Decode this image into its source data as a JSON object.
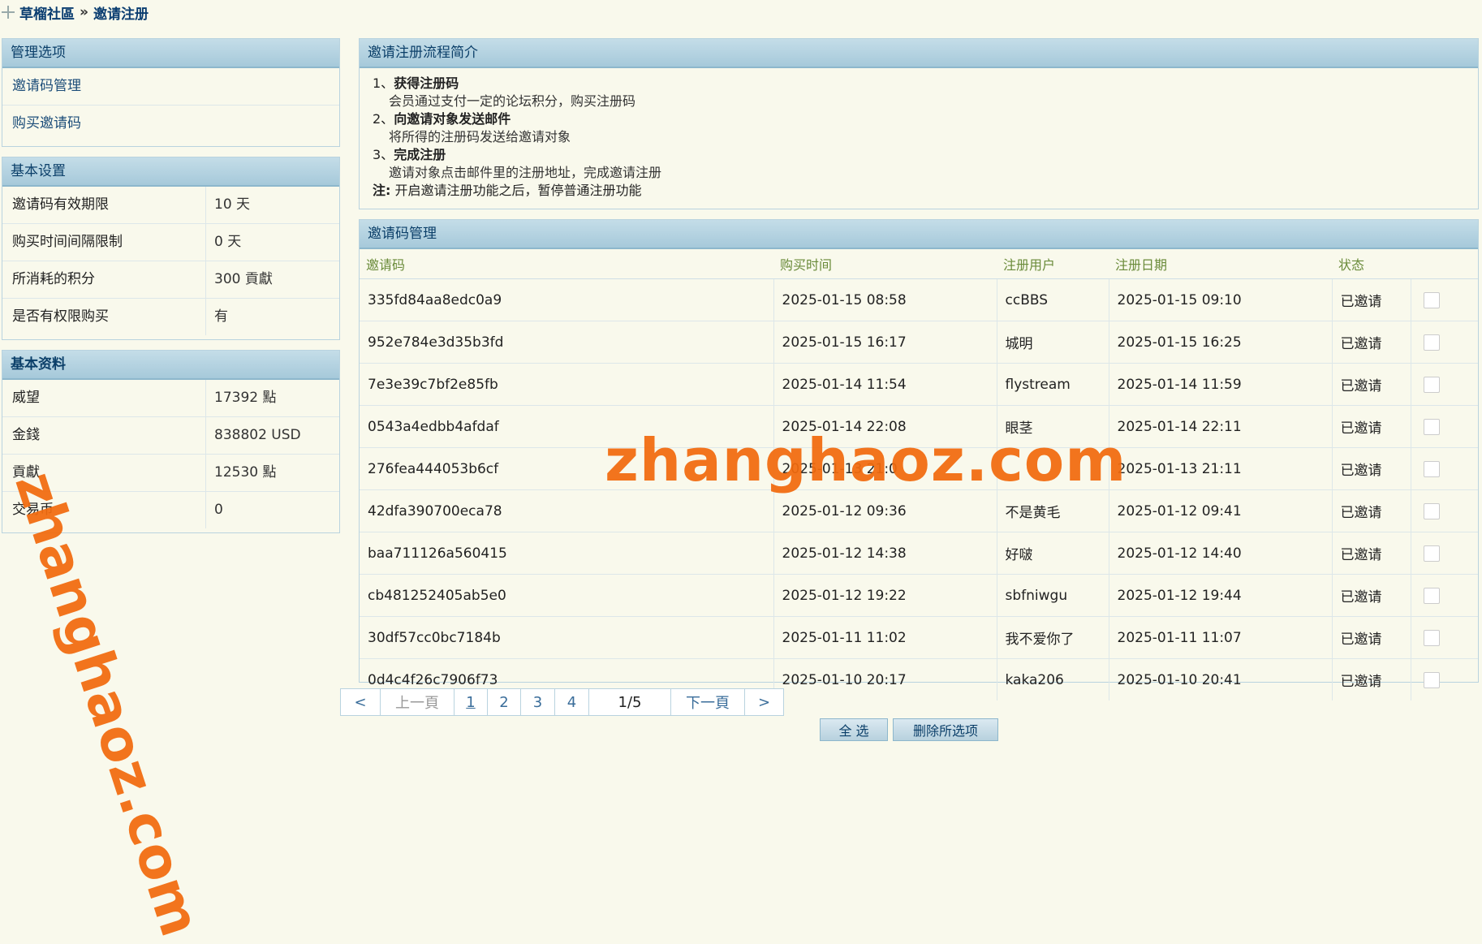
{
  "breadcrumb": {
    "home": "草榴社區",
    "sep": "»",
    "current": "邀请注册"
  },
  "sidebar": {
    "manage": {
      "title": "管理选项",
      "items": [
        "邀请码管理",
        "购买邀请码"
      ]
    },
    "settings": {
      "title": "基本设置",
      "rows": [
        {
          "label": "邀请码有效期限",
          "value": "10 天"
        },
        {
          "label": "购买时间间隔限制",
          "value": "0 天"
        },
        {
          "label": "所消耗的积分",
          "value": "300 貢獻"
        },
        {
          "label": "是否有权限购买",
          "value": "有"
        }
      ]
    },
    "profile": {
      "title": "基本资料",
      "rows": [
        {
          "label": "威望",
          "value": "17392 點"
        },
        {
          "label": "金錢",
          "value": "838802 USD"
        },
        {
          "label": "貢獻",
          "value": "12530 點"
        },
        {
          "label": "交易币",
          "value": "0"
        }
      ]
    }
  },
  "intro": {
    "title": "邀请注册流程简介",
    "steps": [
      {
        "num": "1、",
        "title": "获得注册码",
        "desc": "会员通过支付一定的论坛积分，购买注册码"
      },
      {
        "num": "2、",
        "title": "向邀请对象发送邮件",
        "desc": "将所得的注册码发送给邀请对象"
      },
      {
        "num": "3、",
        "title": "完成注册",
        "desc": "邀请对象点击邮件里的注册地址，完成邀请注册"
      }
    ],
    "note_label": "注:",
    "note": "开启邀请注册功能之后，暂停普通注册功能"
  },
  "codes": {
    "title": "邀请码管理",
    "headers": [
      "邀请码",
      "购买时间",
      "注册用户",
      "注册日期",
      "状态"
    ],
    "rows": [
      {
        "code": "335fd84aa8edc0a9",
        "buy": "2025-01-15 08:58",
        "user": "ccBBS",
        "reg": "2025-01-15 09:10",
        "status": "已邀请"
      },
      {
        "code": "952e784e3d35b3fd",
        "buy": "2025-01-15 16:17",
        "user": "城明",
        "reg": "2025-01-15 16:25",
        "status": "已邀请"
      },
      {
        "code": "7e3e39c7bf2e85fb",
        "buy": "2025-01-14 11:54",
        "user": "flystream",
        "reg": "2025-01-14 11:59",
        "status": "已邀请"
      },
      {
        "code": "0543a4edbb4afdaf",
        "buy": "2025-01-14 22:08",
        "user": "眼茎",
        "reg": "2025-01-14 22:11",
        "status": "已邀请"
      },
      {
        "code": "276fea444053b6cf",
        "buy": "2025-01-13 21:0",
        "user": "",
        "reg": "2025-01-13 21:11",
        "status": "已邀请"
      },
      {
        "code": "42dfa390700eca78",
        "buy": "2025-01-12 09:36",
        "user": "不是黄毛",
        "reg": "2025-01-12 09:41",
        "status": "已邀请"
      },
      {
        "code": "baa711126a560415",
        "buy": "2025-01-12 14:38",
        "user": "好啵",
        "reg": "2025-01-12 14:40",
        "status": "已邀请"
      },
      {
        "code": "cb481252405ab5e0",
        "buy": "2025-01-12 19:22",
        "user": "sbfniwgu",
        "reg": "2025-01-12 19:44",
        "status": "已邀请"
      },
      {
        "code": "30df57cc0bc7184b",
        "buy": "2025-01-11 11:02",
        "user": "我不爱你了",
        "reg": "2025-01-11 11:07",
        "status": "已邀请"
      },
      {
        "code": "0d4c4f26c7906f73",
        "buy": "2025-01-10 20:17",
        "user": "kaka206",
        "reg": "2025-01-10 20:41",
        "status": "已邀请"
      }
    ]
  },
  "pager": {
    "first": "<",
    "prev": "上一頁",
    "pages": [
      "1",
      "2",
      "3",
      "4"
    ],
    "info": "1/5",
    "next": "下一頁",
    "last": ">"
  },
  "actions": {
    "select_all": "全 选",
    "delete": "删除所选项"
  },
  "watermark": "zhanghaoz.com"
}
